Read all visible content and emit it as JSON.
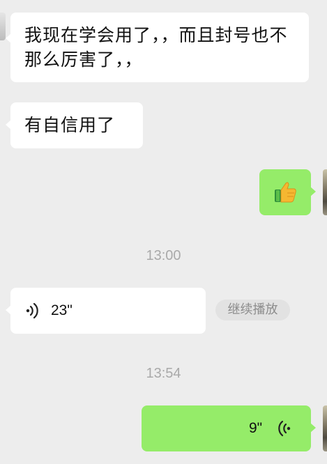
{
  "messages": [
    {
      "side": "in",
      "text": "我现在学会用了，，而且封号也不那么厉害了，，"
    },
    {
      "side": "in",
      "text": "有自信用了"
    },
    {
      "side": "out",
      "emoji": "👍"
    }
  ],
  "timestamps": [
    "13:00",
    "13:54"
  ],
  "voice_in": {
    "duration": "23\"",
    "action": "继续播放"
  },
  "voice_out": {
    "duration": "9\""
  },
  "colors": {
    "background": "#ededed",
    "incoming": "#ffffff",
    "outgoing": "#95ec69",
    "timestamp": "#a9a9a9"
  },
  "icons": [
    "voice-wave-icon",
    "thumbs-up-icon"
  ]
}
